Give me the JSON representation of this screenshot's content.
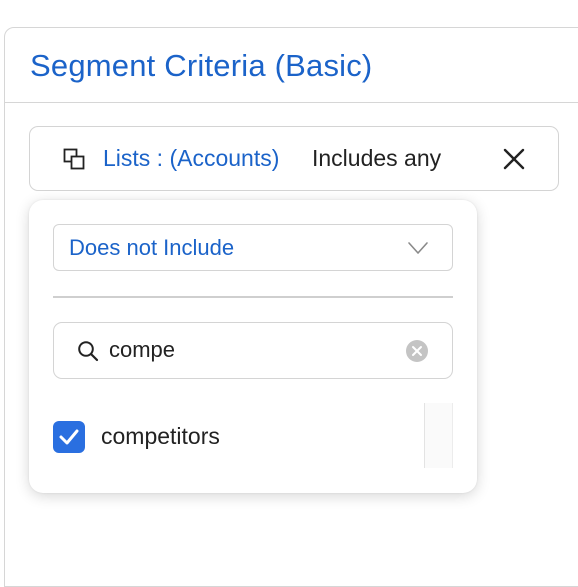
{
  "panel": {
    "title": "Segment Criteria (Basic)"
  },
  "criteria_chip": {
    "field_label": "Lists : (Accounts)",
    "operator_label": "Includes any",
    "icon": "list-copy-icon",
    "close_icon": "close-icon"
  },
  "dropdown": {
    "operator_select": {
      "value": "Does not Include",
      "icon": "chevron-down-icon"
    },
    "search": {
      "value": "compe",
      "icon": "search-icon",
      "clear_icon": "clear-circle-icon"
    },
    "options": [
      {
        "label": "competitors",
        "checked": true
      }
    ]
  },
  "colors": {
    "accent": "#1b63c9",
    "checkbox": "#2a6fe0",
    "border": "#d4d4d4",
    "text": "#222222"
  }
}
